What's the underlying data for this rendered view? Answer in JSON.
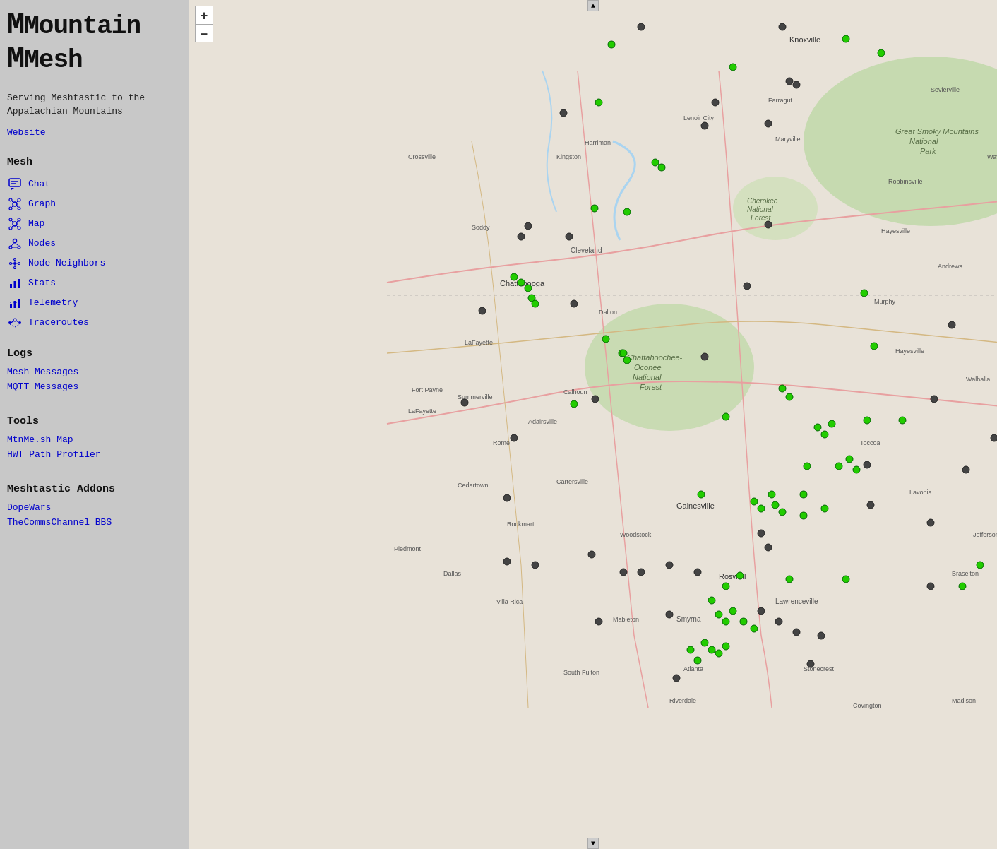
{
  "app": {
    "title_line1": "Mountain",
    "title_line2": "Mesh",
    "description": "Serving Meshtastic to the Appalachian Mountains"
  },
  "sidebar": {
    "website_label": "Website",
    "website_url": "#",
    "mesh_section": "Mesh",
    "nav_items": [
      {
        "id": "chat",
        "label": "Chat",
        "icon": "chat"
      },
      {
        "id": "graph",
        "label": "Graph",
        "icon": "graph"
      },
      {
        "id": "map",
        "label": "Map",
        "icon": "map"
      },
      {
        "id": "nodes",
        "label": "Nodes",
        "icon": "nodes"
      },
      {
        "id": "node-neighbors",
        "label": "Node Neighbors",
        "icon": "node-neighbors"
      },
      {
        "id": "stats",
        "label": "Stats",
        "icon": "stats"
      },
      {
        "id": "telemetry",
        "label": "Telemetry",
        "icon": "telemetry"
      },
      {
        "id": "traceroutes",
        "label": "Traceroutes",
        "icon": "traceroutes"
      }
    ],
    "logs_section": "Logs",
    "log_items": [
      {
        "id": "mesh-messages",
        "label": "Mesh Messages"
      },
      {
        "id": "mqtt-messages",
        "label": "MQTT Messages"
      }
    ],
    "tools_section": "Tools",
    "tool_items": [
      {
        "id": "mtnme-map",
        "label": "MtnMe.sh Map"
      },
      {
        "id": "hwt-path-profiler",
        "label": "HWT Path Profiler"
      }
    ],
    "addons_section": "Meshtastic Addons",
    "addon_items": [
      {
        "id": "dopewars",
        "label": "DopeWars"
      },
      {
        "id": "thecommschannel-bbs",
        "label": "TheCommsChannel BBS"
      }
    ]
  },
  "map": {
    "zoom_in_label": "+",
    "zoom_out_label": "–",
    "accent_color": "#00ff00",
    "node_color_active": "#00cc00",
    "node_color_inactive": "#444444"
  }
}
